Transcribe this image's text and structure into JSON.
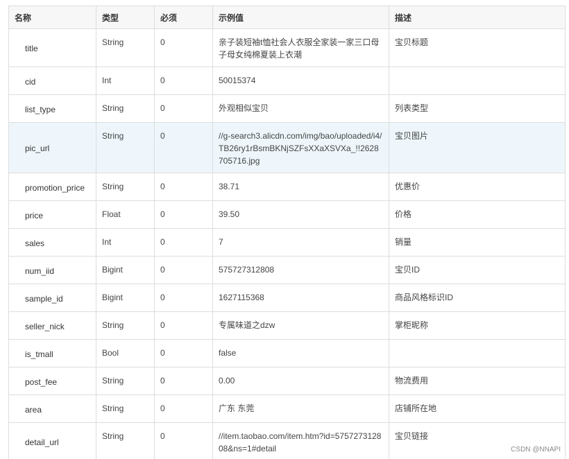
{
  "table": {
    "headers": [
      "名称",
      "类型",
      "必须",
      "示例值",
      "描述"
    ],
    "rows": [
      {
        "name": "title",
        "type": "String",
        "required": "0",
        "example": "亲子装短袖t恤社会人衣服全家装一家三口母子母女纯棉夏装上衣潮",
        "desc": "宝贝标题"
      },
      {
        "name": "cid",
        "type": "Int",
        "required": "0",
        "example": "50015374",
        "desc": ""
      },
      {
        "name": "list_type",
        "type": "String",
        "required": "0",
        "example": "外观相似宝贝",
        "desc": "列表类型"
      },
      {
        "name": "pic_url",
        "type": "String",
        "required": "0",
        "example": "//g-search3.alicdn.com/img/bao/uploaded/i4/TB26ry1rBsmBKNjSZFsXXaXSVXa_!!2628705716.jpg",
        "desc": "宝贝图片"
      },
      {
        "name": "promotion_price",
        "type": "String",
        "required": "0",
        "example": "38.71",
        "desc": "优惠价"
      },
      {
        "name": "price",
        "type": "Float",
        "required": "0",
        "example": "39.50",
        "desc": "价格"
      },
      {
        "name": "sales",
        "type": "Int",
        "required": "0",
        "example": "7",
        "desc": "销量"
      },
      {
        "name": "num_iid",
        "type": "Bigint",
        "required": "0",
        "example": "575727312808",
        "desc": "宝贝ID"
      },
      {
        "name": "sample_id",
        "type": "Bigint",
        "required": "0",
        "example": "1627115368",
        "desc": "商品风格标识ID"
      },
      {
        "name": "seller_nick",
        "type": "String",
        "required": "0",
        "example": "专属味道之dzw",
        "desc": "掌柜昵称"
      },
      {
        "name": "is_tmall",
        "type": "Bool",
        "required": "0",
        "example": "false",
        "desc": ""
      },
      {
        "name": "post_fee",
        "type": "String",
        "required": "0",
        "example": "0.00",
        "desc": "物流费用"
      },
      {
        "name": "area",
        "type": "String",
        "required": "0",
        "example": "广东 东莞",
        "desc": "店铺所在地"
      },
      {
        "name": "detail_url",
        "type": "String",
        "required": "0",
        "example": "//item.taobao.com/item.htm?id=575727312808&ns=1#detail",
        "desc": "宝贝链接"
      }
    ]
  },
  "watermark": "CSDN @NNAPI"
}
